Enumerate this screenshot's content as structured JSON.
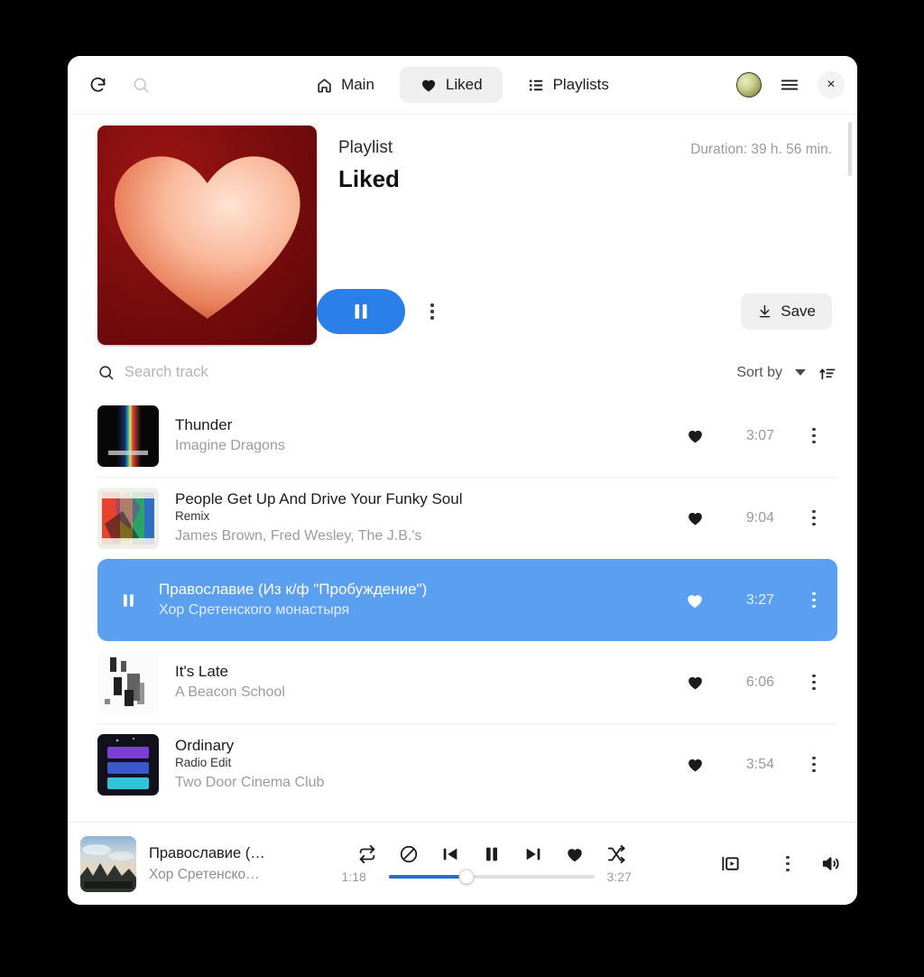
{
  "window": {
    "header": {
      "refresh_icon": "refresh-icon",
      "search_icon": "search-icon",
      "menu_icon": "hamburger-menu-icon",
      "close_label": "×",
      "tabs": [
        {
          "label": "Main",
          "icon": "home-icon",
          "active": false
        },
        {
          "label": "Liked",
          "icon": "heart-icon",
          "active": true
        },
        {
          "label": "Playlists",
          "icon": "list-icon",
          "active": false
        }
      ]
    },
    "hero": {
      "kicker": "Playlist",
      "title": "Liked",
      "duration": "Duration: 39 h. 56 min.",
      "play_icon": "pause-icon",
      "more_icon": "kebab-menu-icon",
      "save_label": "Save",
      "save_icon": "download-icon",
      "cover_bg": "#7d0d0e",
      "cover_heart": "#f6b79c"
    },
    "toolbar": {
      "search_placeholder": "Search track",
      "search_value": "",
      "sort_label": "Sort by",
      "sort_order_icon": "sort-ascending-icon"
    },
    "tracks": [
      {
        "title": "Thunder",
        "subtitle": "",
        "artist": "Imagine Dragons",
        "duration": "3:07",
        "liked": true,
        "active": false,
        "cover": "evolve"
      },
      {
        "title": "People Get Up And Drive Your Funky Soul",
        "subtitle": "Remix",
        "artist": "James Brown, Fred Wesley, The J.B.'s",
        "duration": "9:04",
        "liked": true,
        "active": false,
        "cover": "funky"
      },
      {
        "title": "Православие (Из к/ф \"Пробуждение\")",
        "subtitle": "",
        "artist": "Хор Сретенского монастыря",
        "duration": "3:27",
        "liked": true,
        "active": true,
        "cover": "sky"
      },
      {
        "title": "It's Late",
        "subtitle": "",
        "artist": "A Beacon School",
        "duration": "6:06",
        "liked": true,
        "active": false,
        "cover": "late"
      },
      {
        "title": "Ordinary",
        "subtitle": "Radio Edit",
        "artist": "Two Door Cinema Club",
        "duration": "3:54",
        "liked": true,
        "active": false,
        "cover": "ordinary"
      }
    ],
    "player": {
      "title": "Православие (…",
      "artist": "Хор Сретенско…",
      "elapsed": "1:18",
      "total": "3:27",
      "progress_percent": 38,
      "repeat_icon": "repeat-icon",
      "block_icon": "no-crossfade-icon",
      "prev_icon": "previous-track-icon",
      "playpause_icon": "pause-icon",
      "next_icon": "next-track-icon",
      "like_icon": "heart-icon",
      "shuffle_icon": "shuffle-icon",
      "queue_icon": "queue-panel-icon",
      "more_icon": "kebab-menu-icon",
      "volume_icon": "volume-icon",
      "accent": "#1f6fd0"
    }
  }
}
